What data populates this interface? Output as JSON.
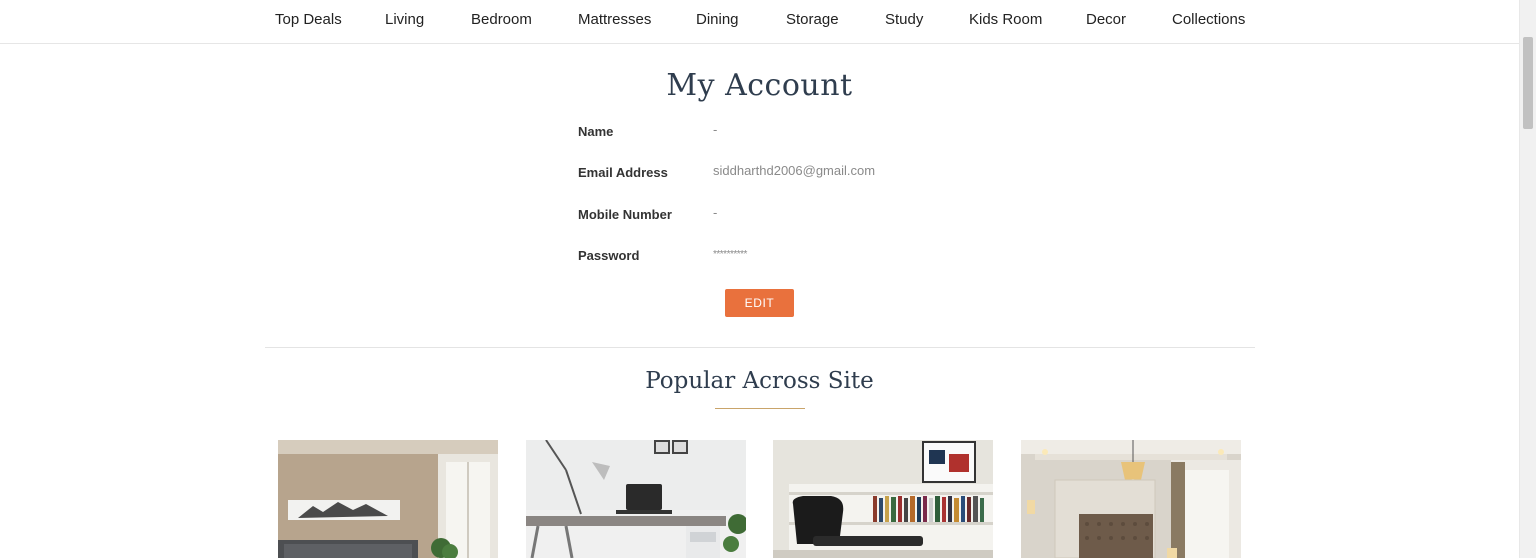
{
  "nav": {
    "items": [
      "Top Deals",
      "Living",
      "Bedroom",
      "Mattresses",
      "Dining",
      "Storage",
      "Study",
      "Kids Room",
      "Decor",
      "Collections"
    ]
  },
  "account": {
    "title": "My Account",
    "fields": [
      {
        "label": "Name",
        "value": "-"
      },
      {
        "label": "Email Address",
        "value": "siddharthd2006@gmail.com"
      },
      {
        "label": "Mobile Number",
        "value": "-"
      },
      {
        "label": "Password",
        "value": "**********"
      }
    ],
    "edit_label": "EDIT"
  },
  "popular": {
    "title": "Popular Across Site",
    "products": [
      {
        "icon": "bedroom-photo"
      },
      {
        "icon": "study-desk-photo"
      },
      {
        "icon": "bookshelf-lounge-chair-photo"
      },
      {
        "icon": "luxury-bedroom-photo"
      }
    ]
  },
  "colors": {
    "accent": "#e9713d",
    "heading": "#2f3d4e",
    "underline": "#c9a46a"
  }
}
